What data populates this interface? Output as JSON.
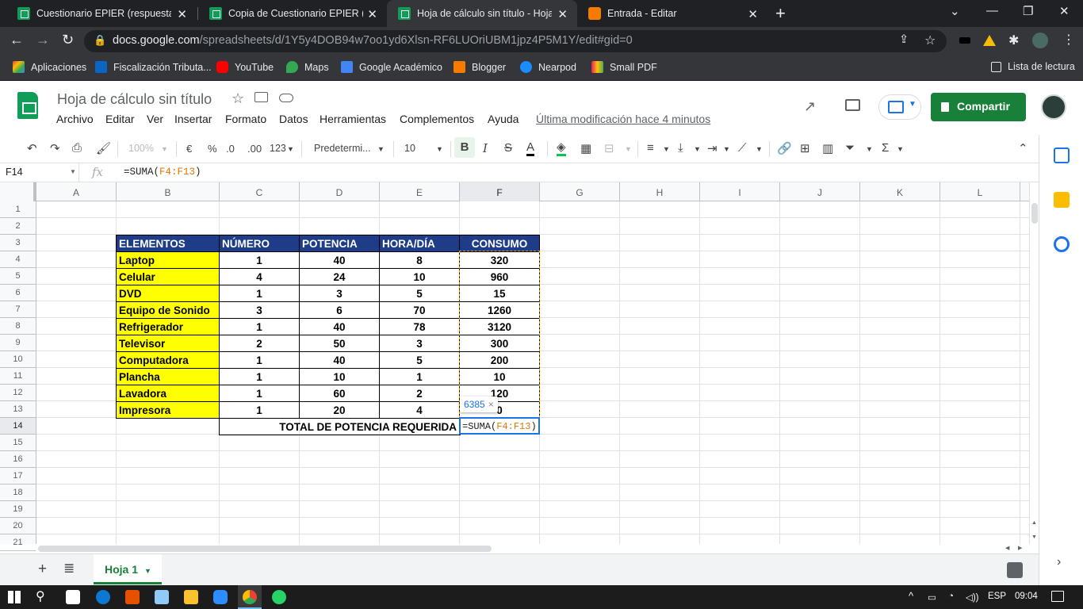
{
  "browser": {
    "tabs": [
      {
        "title": "Cuestionario EPIER (respuestas) -",
        "icon": "sheets-icon",
        "active": false
      },
      {
        "title": "Copia de Cuestionario EPIER (resp",
        "icon": "sheets-icon",
        "active": false
      },
      {
        "title": "Hoja de cálculo sin título - Hojas",
        "icon": "sheets-icon",
        "active": true
      },
      {
        "title": "Entrada - Editar",
        "icon": "blogger-icon",
        "active": false
      }
    ],
    "url_domain": "docs.google.com",
    "url_path": "/spreadsheets/d/1Y5y4DOB94w7oo1yd6Xlsn-RF6LUOriUBM1jpz4P5M1Y/edit#gid=0",
    "bookmarks": [
      "Aplicaciones",
      "Fiscalización Tributa...",
      "YouTube",
      "Maps",
      "Google Académico",
      "Blogger",
      "Nearpod",
      "Small PDF"
    ],
    "reading_list": "Lista de lectura"
  },
  "sheets": {
    "doc_title": "Hoja de cálculo sin título",
    "menu": [
      "Archivo",
      "Editar",
      "Ver",
      "Insertar",
      "Formato",
      "Datos",
      "Herramientas",
      "Complementos",
      "Ayuda"
    ],
    "last_modified": "Última modificación hace 4 minutos",
    "share_label": "Compartir",
    "toolbar": {
      "zoom": "100%",
      "currency": "€",
      "percent": "%",
      "dec_less": ".0",
      "dec_more": ".00",
      "more_formats": "123",
      "font": "Predetermi...",
      "font_size": "10",
      "bold": "B",
      "italic": "I",
      "strike": "S",
      "text_color": "A"
    },
    "name_box": "F14",
    "fx": "fx",
    "formula_prefix": "=SUMA(",
    "formula_ref": "F4:F13",
    "formula_suffix": ")",
    "columns": [
      "A",
      "B",
      "C",
      "D",
      "E",
      "F",
      "G",
      "H",
      "I",
      "J",
      "K",
      "L"
    ],
    "rows": [
      "1",
      "2",
      "3",
      "4",
      "5",
      "6",
      "7",
      "8",
      "9",
      "10",
      "11",
      "12",
      "13",
      "14",
      "15",
      "16",
      "17",
      "18",
      "19",
      "20",
      "21"
    ],
    "table": {
      "headers": [
        "ELEMENTOS",
        "NÚMERO",
        "POTENCIA",
        "HORA/DÍA",
        "CONSUMO"
      ],
      "rows": [
        [
          "Laptop",
          "1",
          "40",
          "8",
          "320"
        ],
        [
          "Celular",
          "4",
          "24",
          "10",
          "960"
        ],
        [
          "DVD",
          "1",
          "3",
          "5",
          "15"
        ],
        [
          "Equipo de Sonido",
          "3",
          "6",
          "70",
          "1260"
        ],
        [
          "Refrigerador",
          "1",
          "40",
          "78",
          "3120"
        ],
        [
          "Televisor",
          "2",
          "50",
          "3",
          "300"
        ],
        [
          "Computadora",
          "1",
          "40",
          "5",
          "200"
        ],
        [
          "Plancha",
          "1",
          "10",
          "1",
          "10"
        ],
        [
          "Lavadora",
          "1",
          "60",
          "2",
          "120"
        ],
        [
          "Impresora",
          "1",
          "20",
          "4",
          "0"
        ]
      ],
      "total_label": "TOTAL DE POTENCIA REQUERIDA"
    },
    "tooltip_value": "6385",
    "tooltip_close": "×",
    "sheet_tab": "Hoja 1"
  },
  "taskbar": {
    "lang": "ESP",
    "time": "09:04"
  }
}
